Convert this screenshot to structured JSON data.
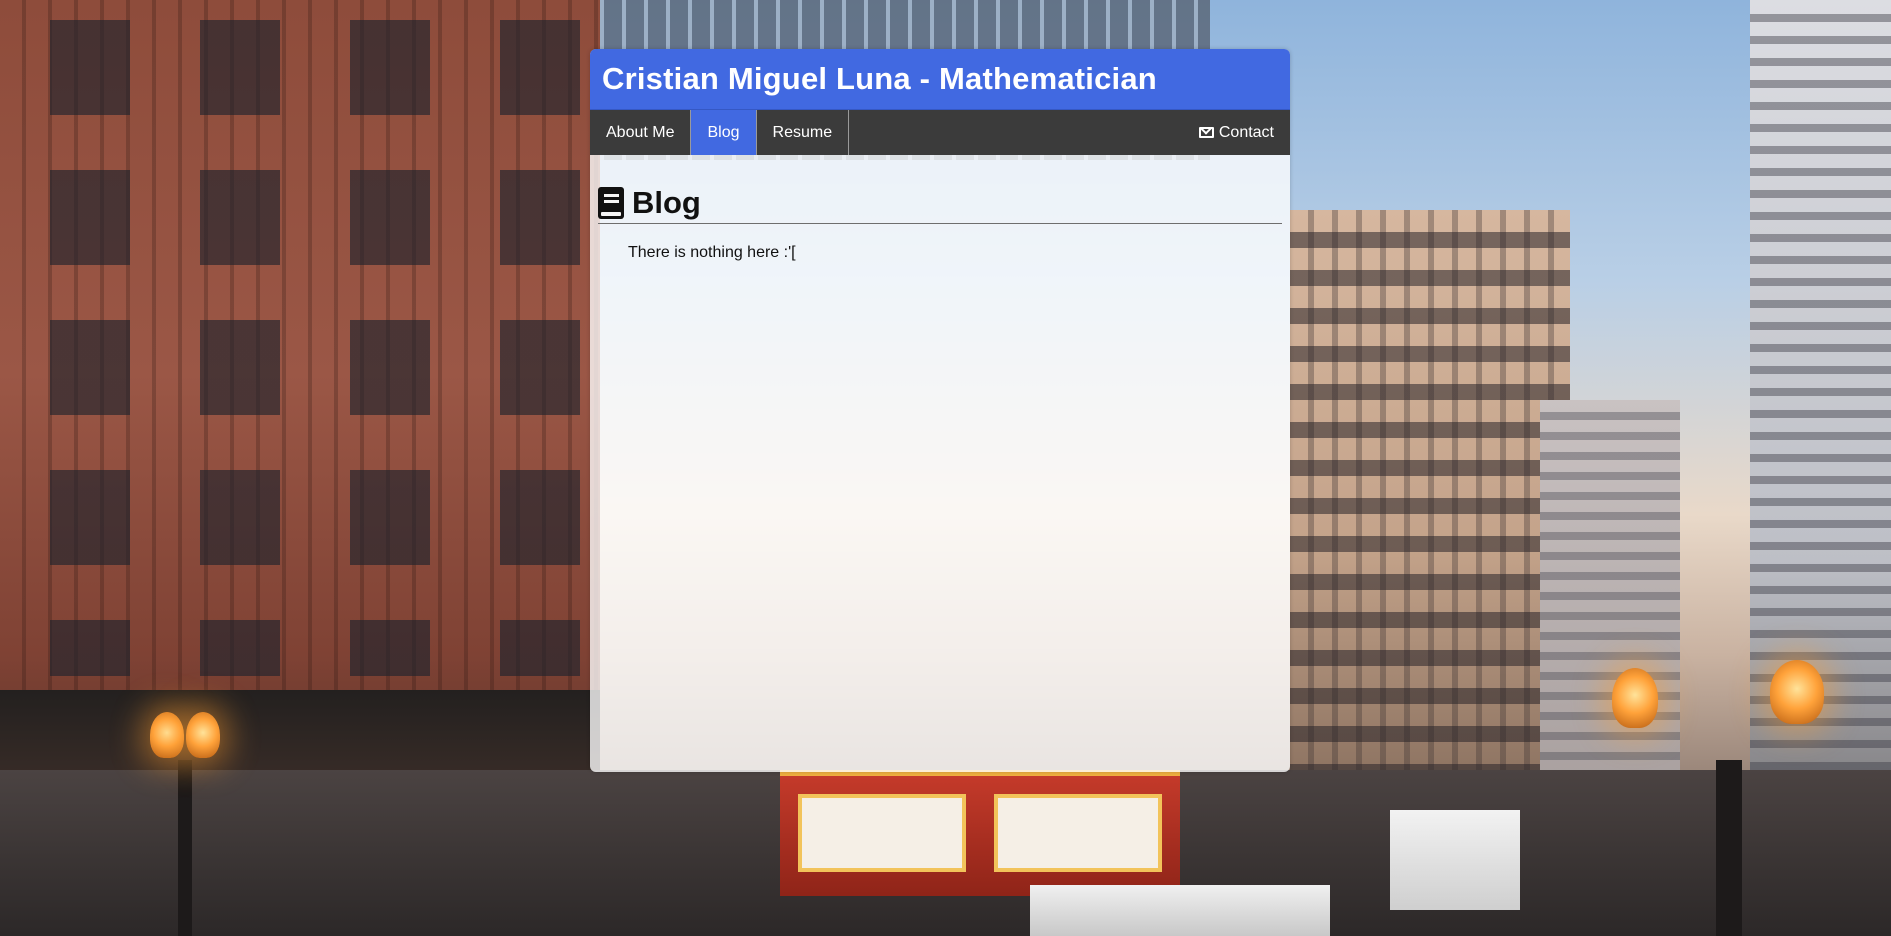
{
  "site": {
    "title": "Cristian Miguel Luna - Mathematician",
    "accent_color": "#4169e1",
    "nav_background": "#3b3b3b"
  },
  "nav": {
    "items": [
      {
        "label": "About Me",
        "active": false
      },
      {
        "label": "Blog",
        "active": true
      },
      {
        "label": "Resume",
        "active": false
      }
    ],
    "contact": {
      "label": "Contact",
      "icon": "envelope-icon"
    }
  },
  "main": {
    "heading": "Blog",
    "heading_icon": "book-icon",
    "message": "There is nothing here :'["
  }
}
